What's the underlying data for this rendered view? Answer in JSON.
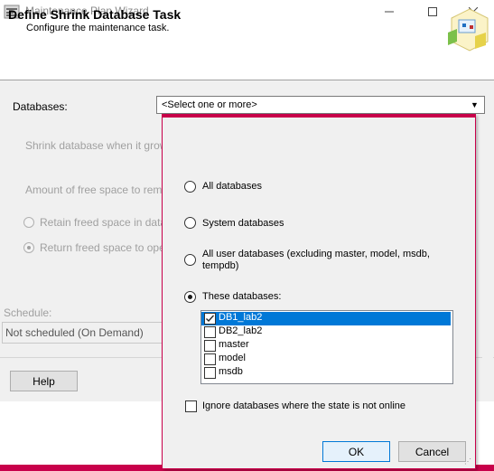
{
  "window": {
    "title": "Maintenance Plan Wizard",
    "controls": [
      "minimize",
      "maximize",
      "close"
    ]
  },
  "header": {
    "title": "Define Shrink Database Task",
    "subtitle": "Configure the maintenance task."
  },
  "form": {
    "databases_label": "Databases:",
    "databases_value": "<Select one or more>",
    "shrink_label": "Shrink database when it grows b",
    "free_space_label": "Amount of free space to remain a",
    "retain_label": "Retain freed space in databa",
    "return_label": "Return freed space to operat",
    "return_selected": true,
    "schedule_label": "Schedule:",
    "schedule_value": "Not scheduled (On Demand)",
    "help_label": "Help"
  },
  "popup": {
    "options": {
      "all": "All databases",
      "system": "System databases",
      "user": "All user databases  (excluding master, model, msdb, tempdb)",
      "these": "These databases:"
    },
    "selected_option": "these",
    "databases": [
      {
        "name": "DB1_lab2",
        "checked": true,
        "highlighted": true
      },
      {
        "name": "DB2_lab2",
        "checked": false,
        "highlighted": false
      },
      {
        "name": "master",
        "checked": false,
        "highlighted": false
      },
      {
        "name": "model",
        "checked": false,
        "highlighted": false
      },
      {
        "name": "msdb",
        "checked": false,
        "highlighted": false
      }
    ],
    "ignore_offline_label": "Ignore databases where the state is not online",
    "ignore_offline_checked": false,
    "ok_label": "OK",
    "cancel_label": "Cancel"
  },
  "colors": {
    "accent_border": "#c8004a",
    "selection": "#0078d7",
    "panel": "#f0f0f0"
  }
}
